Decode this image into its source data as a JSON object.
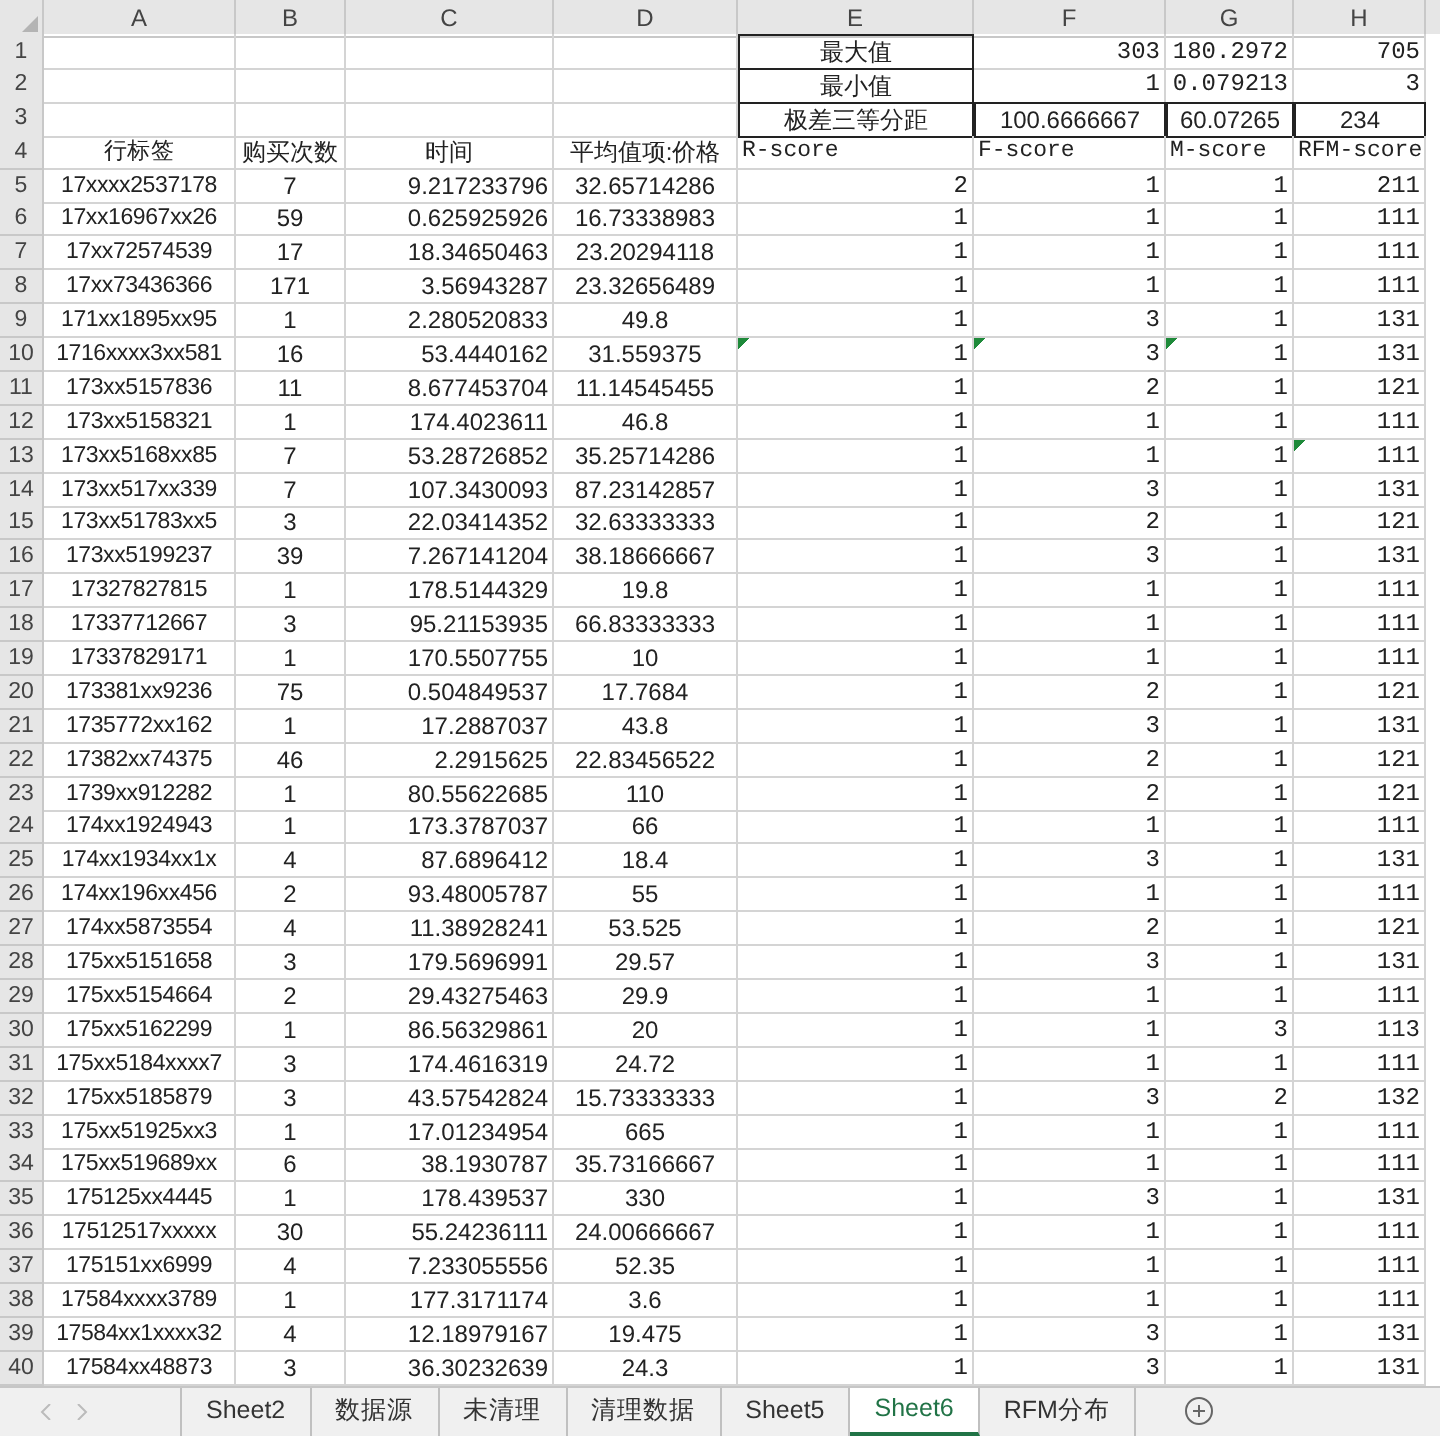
{
  "sheet": {
    "columns": [
      "A",
      "B",
      "C",
      "D",
      "E",
      "F",
      "G",
      "H"
    ],
    "rows": [
      {
        "number": "1",
        "cells": [
          null,
          null,
          null,
          null,
          "最大值",
          "303",
          "180.2972",
          "705"
        ],
        "marked": [
          false,
          false,
          false,
          false,
          false,
          false,
          false,
          false
        ]
      },
      {
        "number": "2",
        "cells": [
          null,
          null,
          null,
          null,
          "最小值",
          "1",
          "0.079213",
          "3"
        ],
        "marked": [
          false,
          false,
          false,
          false,
          false,
          false,
          false,
          false
        ]
      },
      {
        "number": "3",
        "cells": [
          null,
          null,
          null,
          null,
          "极差三等分距",
          "100.6666667",
          "60.07265",
          "234"
        ],
        "marked": [
          false,
          false,
          false,
          false,
          false,
          false,
          false,
          false
        ]
      },
      {
        "number": "4",
        "cells": [
          "行标签",
          "购买次数",
          "时间",
          "平均值项:价格",
          "R-score",
          "F-score",
          "M-score",
          "RFM-score"
        ],
        "marked": [
          false,
          false,
          false,
          false,
          false,
          false,
          false,
          false
        ]
      },
      {
        "number": "5",
        "cells": [
          "17xxxx2537178",
          "7",
          "9.217233796",
          "32.65714286",
          "2",
          "1",
          "1",
          "211"
        ],
        "marked": [
          false,
          false,
          false,
          false,
          false,
          false,
          false,
          false
        ]
      },
      {
        "number": "6",
        "cells": [
          "17xx16967xx26",
          "59",
          "0.625925926",
          "16.73338983",
          "1",
          "1",
          "1",
          "111"
        ],
        "marked": [
          false,
          false,
          false,
          false,
          false,
          false,
          false,
          false
        ]
      },
      {
        "number": "7",
        "cells": [
          "17xx72574539",
          "17",
          "18.34650463",
          "23.20294118",
          "1",
          "1",
          "1",
          "111"
        ],
        "marked": [
          false,
          false,
          false,
          false,
          false,
          false,
          false,
          false
        ]
      },
      {
        "number": "8",
        "cells": [
          "17xx73436366",
          "171",
          "3.56943287",
          "23.32656489",
          "1",
          "1",
          "1",
          "111"
        ],
        "marked": [
          false,
          false,
          false,
          false,
          false,
          false,
          false,
          false
        ]
      },
      {
        "number": "9",
        "cells": [
          "171xx1895xx95",
          "1",
          "2.280520833",
          "49.8",
          "1",
          "3",
          "1",
          "131"
        ],
        "marked": [
          false,
          false,
          false,
          false,
          false,
          false,
          false,
          false
        ]
      },
      {
        "number": "10",
        "cells": [
          "1716xxxx3xx581",
          "16",
          "53.4440162",
          "31.559375",
          "1",
          "3",
          "1",
          "131"
        ],
        "marked": [
          false,
          false,
          false,
          false,
          true,
          true,
          true,
          false
        ]
      },
      {
        "number": "11",
        "cells": [
          "173xx5157836",
          "11",
          "8.677453704",
          "11.14545455",
          "1",
          "2",
          "1",
          "121"
        ],
        "marked": [
          false,
          false,
          false,
          false,
          false,
          false,
          false,
          false
        ]
      },
      {
        "number": "12",
        "cells": [
          "173xx5158321",
          "1",
          "174.4023611",
          "46.8",
          "1",
          "1",
          "1",
          "111"
        ],
        "marked": [
          false,
          false,
          false,
          false,
          false,
          false,
          false,
          false
        ]
      },
      {
        "number": "13",
        "cells": [
          "173xx5168xx85",
          "7",
          "53.28726852",
          "35.25714286",
          "1",
          "1",
          "1",
          "111"
        ],
        "marked": [
          false,
          false,
          false,
          false,
          false,
          false,
          false,
          true
        ]
      },
      {
        "number": "14",
        "cells": [
          "173xx517xx339",
          "7",
          "107.3430093",
          "87.23142857",
          "1",
          "3",
          "1",
          "131"
        ],
        "marked": [
          false,
          false,
          false,
          false,
          false,
          false,
          false,
          false
        ]
      },
      {
        "number": "15",
        "cells": [
          "173xx51783xx5",
          "3",
          "22.03414352",
          "32.63333333",
          "1",
          "2",
          "1",
          "121"
        ],
        "marked": [
          false,
          false,
          false,
          false,
          false,
          false,
          false,
          false
        ]
      },
      {
        "number": "16",
        "cells": [
          "173xx5199237",
          "39",
          "7.267141204",
          "38.18666667",
          "1",
          "3",
          "1",
          "131"
        ],
        "marked": [
          false,
          false,
          false,
          false,
          false,
          false,
          false,
          false
        ]
      },
      {
        "number": "17",
        "cells": [
          "17327827815",
          "1",
          "178.5144329",
          "19.8",
          "1",
          "1",
          "1",
          "111"
        ],
        "marked": [
          false,
          false,
          false,
          false,
          false,
          false,
          false,
          false
        ]
      },
      {
        "number": "18",
        "cells": [
          "17337712667",
          "3",
          "95.21153935",
          "66.83333333",
          "1",
          "1",
          "1",
          "111"
        ],
        "marked": [
          false,
          false,
          false,
          false,
          false,
          false,
          false,
          false
        ]
      },
      {
        "number": "19",
        "cells": [
          "17337829171",
          "1",
          "170.5507755",
          "10",
          "1",
          "1",
          "1",
          "111"
        ],
        "marked": [
          false,
          false,
          false,
          false,
          false,
          false,
          false,
          false
        ]
      },
      {
        "number": "20",
        "cells": [
          "173381xx9236",
          "75",
          "0.504849537",
          "17.7684",
          "1",
          "2",
          "1",
          "121"
        ],
        "marked": [
          false,
          false,
          false,
          false,
          false,
          false,
          false,
          false
        ]
      },
      {
        "number": "21",
        "cells": [
          "1735772xx162",
          "1",
          "17.2887037",
          "43.8",
          "1",
          "3",
          "1",
          "131"
        ],
        "marked": [
          false,
          false,
          false,
          false,
          false,
          false,
          false,
          false
        ]
      },
      {
        "number": "22",
        "cells": [
          "17382xx74375",
          "46",
          "2.2915625",
          "22.83456522",
          "1",
          "2",
          "1",
          "121"
        ],
        "marked": [
          false,
          false,
          false,
          false,
          false,
          false,
          false,
          false
        ]
      },
      {
        "number": "23",
        "cells": [
          "1739xx912282",
          "1",
          "80.55622685",
          "110",
          "1",
          "2",
          "1",
          "121"
        ],
        "marked": [
          false,
          false,
          false,
          false,
          false,
          false,
          false,
          false
        ]
      },
      {
        "number": "24",
        "cells": [
          "174xx1924943",
          "1",
          "173.3787037",
          "66",
          "1",
          "1",
          "1",
          "111"
        ],
        "marked": [
          false,
          false,
          false,
          false,
          false,
          false,
          false,
          false
        ]
      },
      {
        "number": "25",
        "cells": [
          "174xx1934xx1x",
          "4",
          "87.6896412",
          "18.4",
          "1",
          "3",
          "1",
          "131"
        ],
        "marked": [
          false,
          false,
          false,
          false,
          false,
          false,
          false,
          false
        ]
      },
      {
        "number": "26",
        "cells": [
          "174xx196xx456",
          "2",
          "93.48005787",
          "55",
          "1",
          "1",
          "1",
          "111"
        ],
        "marked": [
          false,
          false,
          false,
          false,
          false,
          false,
          false,
          false
        ]
      },
      {
        "number": "27",
        "cells": [
          "174xx5873554",
          "4",
          "11.38928241",
          "53.525",
          "1",
          "2",
          "1",
          "121"
        ],
        "marked": [
          false,
          false,
          false,
          false,
          false,
          false,
          false,
          false
        ]
      },
      {
        "number": "28",
        "cells": [
          "175xx5151658",
          "3",
          "179.5696991",
          "29.57",
          "1",
          "3",
          "1",
          "131"
        ],
        "marked": [
          false,
          false,
          false,
          false,
          false,
          false,
          false,
          false
        ]
      },
      {
        "number": "29",
        "cells": [
          "175xx5154664",
          "2",
          "29.43275463",
          "29.9",
          "1",
          "1",
          "1",
          "111"
        ],
        "marked": [
          false,
          false,
          false,
          false,
          false,
          false,
          false,
          false
        ]
      },
      {
        "number": "30",
        "cells": [
          "175xx5162299",
          "1",
          "86.56329861",
          "20",
          "1",
          "1",
          "3",
          "113"
        ],
        "marked": [
          false,
          false,
          false,
          false,
          false,
          false,
          false,
          false
        ]
      },
      {
        "number": "31",
        "cells": [
          "175xx5184xxxx7",
          "3",
          "174.4616319",
          "24.72",
          "1",
          "1",
          "1",
          "111"
        ],
        "marked": [
          false,
          false,
          false,
          false,
          false,
          false,
          false,
          false
        ]
      },
      {
        "number": "32",
        "cells": [
          "175xx5185879",
          "3",
          "43.57542824",
          "15.73333333",
          "1",
          "3",
          "2",
          "132"
        ],
        "marked": [
          false,
          false,
          false,
          false,
          false,
          false,
          false,
          false
        ]
      },
      {
        "number": "33",
        "cells": [
          "175xx51925xx3",
          "1",
          "17.01234954",
          "665",
          "1",
          "1",
          "1",
          "111"
        ],
        "marked": [
          false,
          false,
          false,
          false,
          false,
          false,
          false,
          false
        ]
      },
      {
        "number": "34",
        "cells": [
          "175xx519689xx",
          "6",
          "38.1930787",
          "35.73166667",
          "1",
          "1",
          "1",
          "111"
        ],
        "marked": [
          false,
          false,
          false,
          false,
          false,
          false,
          false,
          false
        ]
      },
      {
        "number": "35",
        "cells": [
          "175125xx4445",
          "1",
          "178.439537",
          "330",
          "1",
          "3",
          "1",
          "131"
        ],
        "marked": [
          false,
          false,
          false,
          false,
          false,
          false,
          false,
          false
        ]
      },
      {
        "number": "36",
        "cells": [
          "17512517xxxxx",
          "30",
          "55.24236111",
          "24.00666667",
          "1",
          "1",
          "1",
          "111"
        ],
        "marked": [
          false,
          false,
          false,
          false,
          false,
          false,
          false,
          false
        ]
      },
      {
        "number": "37",
        "cells": [
          "175151xx6999",
          "4",
          "7.233055556",
          "52.35",
          "1",
          "1",
          "1",
          "111"
        ],
        "marked": [
          false,
          false,
          false,
          false,
          false,
          false,
          false,
          false
        ]
      },
      {
        "number": "38",
        "cells": [
          "17584xxxx3789",
          "1",
          "177.3171174",
          "3.6",
          "1",
          "1",
          "1",
          "111"
        ],
        "marked": [
          false,
          false,
          false,
          false,
          false,
          false,
          false,
          false
        ]
      },
      {
        "number": "39",
        "cells": [
          "17584xx1xxxx32",
          "4",
          "12.18979167",
          "19.475",
          "1",
          "3",
          "1",
          "131"
        ],
        "marked": [
          false,
          false,
          false,
          false,
          false,
          false,
          false,
          false
        ]
      },
      {
        "number": "40",
        "cells": [
          "17584xx48873",
          "3",
          "36.30232639",
          "24.3",
          "1",
          "3",
          "1",
          "131"
        ],
        "marked": [
          false,
          false,
          false,
          false,
          false,
          false,
          false,
          false
        ]
      }
    ]
  },
  "tabs": [
    {
      "label": "Sheet2",
      "selected": false
    },
    {
      "label": "数据源",
      "selected": false
    },
    {
      "label": "未清理",
      "selected": false
    },
    {
      "label": "清理数据",
      "selected": false
    },
    {
      "label": "Sheet5",
      "selected": false
    },
    {
      "label": "Sheet6",
      "selected": true
    },
    {
      "label": "RFM分布",
      "selected": false
    }
  ]
}
